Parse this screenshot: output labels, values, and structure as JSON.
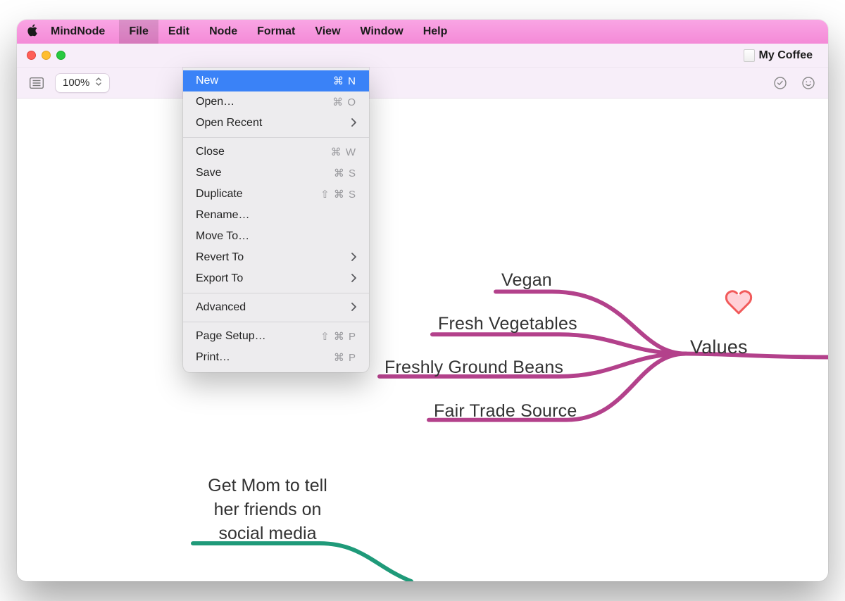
{
  "menubar": {
    "app_name": "MindNode",
    "items": [
      "File",
      "Edit",
      "Node",
      "Format",
      "View",
      "Window",
      "Help"
    ],
    "open_index": 0
  },
  "titlebar": {
    "doc_title": "My Coffee"
  },
  "toolbar": {
    "zoom_value": "100%"
  },
  "file_menu": {
    "groups": [
      [
        {
          "label": "New",
          "shortcut": "⌘ N",
          "highlight": true
        },
        {
          "label": "Open…",
          "shortcut": "⌘ O"
        },
        {
          "label": "Open Recent",
          "submenu": true
        }
      ],
      [
        {
          "label": "Close",
          "shortcut": "⌘ W"
        },
        {
          "label": "Save",
          "shortcut": "⌘ S"
        },
        {
          "label": "Duplicate",
          "shortcut": "⇧ ⌘ S"
        },
        {
          "label": "Rename…"
        },
        {
          "label": "Move To…"
        },
        {
          "label": "Revert To",
          "submenu": true
        },
        {
          "label": "Export To",
          "submenu": true
        }
      ],
      [
        {
          "label": "Advanced",
          "submenu": true
        }
      ],
      [
        {
          "label": "Page Setup…",
          "shortcut": "⇧ ⌘ P"
        },
        {
          "label": "Print…",
          "shortcut": "⌘ P"
        }
      ]
    ]
  },
  "mindmap": {
    "parent_label": "Values",
    "children": [
      "Vegan",
      "Fresh Vegetables",
      "Freshly Ground Beans",
      "Fair Trade Source"
    ],
    "other_branch_text": "Get Mom to tell\nher friends on\nsocial media",
    "branch_color": "#b3418b",
    "other_branch_color": "#1f9a79"
  }
}
